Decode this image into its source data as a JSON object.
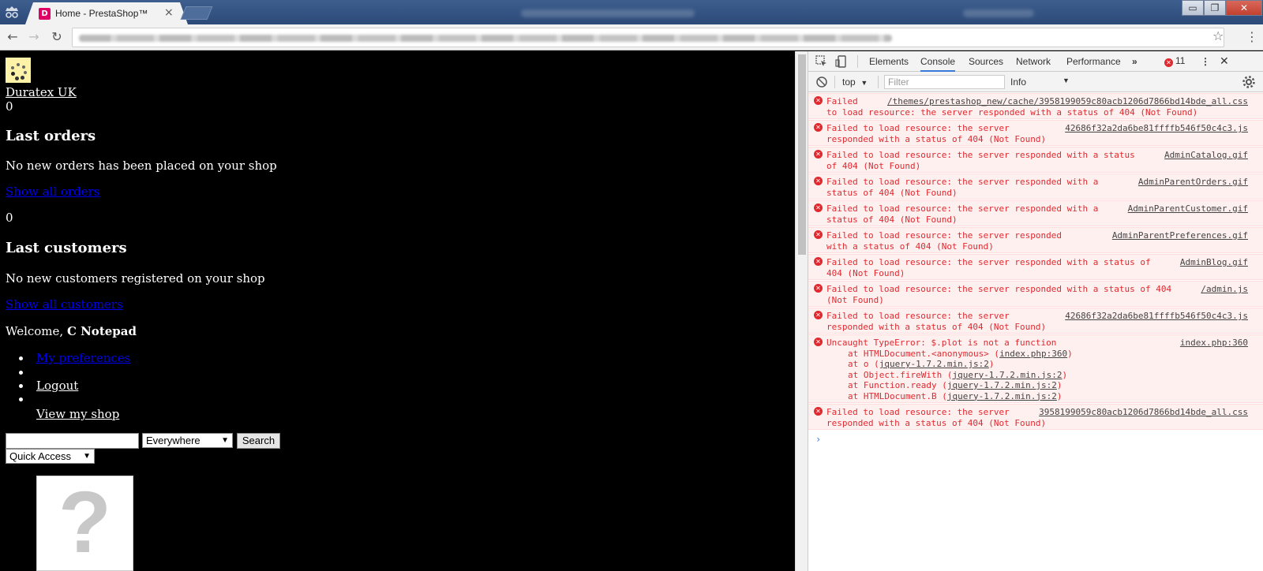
{
  "browser": {
    "tab_title": "Home - PrestaShop™",
    "tab_close": "×",
    "favicon_letter": "D",
    "brand_color": "#df0067",
    "window_controls": {
      "minimize": "▭",
      "maximize": "❐",
      "close": "✕"
    },
    "nav": {
      "back": "←",
      "forward": "→",
      "reload": "↻",
      "bookmark": "☆",
      "menu": "⋮"
    }
  },
  "page": {
    "shop_name": "Duratex UK",
    "orders_count": "0",
    "last_orders_heading": "Last orders",
    "no_orders_text": "No new orders has been placed on your shop",
    "show_all_orders": "Show all orders",
    "customers_count": "0",
    "last_customers_heading": "Last customers",
    "no_customers_text": "No new customers registered on your shop",
    "show_all_customers": "Show all customers",
    "welcome_prefix": "Welcome, ",
    "welcome_name": "C Notepad",
    "menu_links": {
      "preferences": "My preferences",
      "logout": "Logout",
      "view_shop": "View my shop"
    },
    "search": {
      "value": "",
      "scope": "Everywhere",
      "button": "Search"
    },
    "quick_access": "Quick Access",
    "placeholder_glyph": "?"
  },
  "devtools": {
    "tabs": [
      "Elements",
      "Console",
      "Sources",
      "Network",
      "Performance"
    ],
    "active_tab": "Console",
    "more_tabs": "»",
    "error_count": "11",
    "context": "top",
    "filter_placeholder": "Filter",
    "level": "Info",
    "messages": [
      {
        "text": "Failed \nto load resource: the server responded with a status of 404 (Not Found)",
        "src": "/themes/prestashop_new/cache/3958199059c80acb1206d7866bd14bde_all.css"
      },
      {
        "text": "Failed to load resource: the server\nresponded with a status of 404 (Not Found)",
        "src": "42686f32a2da6be81ffffb546f50c4c3.js"
      },
      {
        "text": "Failed to load resource: the server responded with a status\nof 404 (Not Found)",
        "src": "AdminCatalog.gif"
      },
      {
        "text": "Failed to load resource: the server responded with a\nstatus of 404 (Not Found)",
        "src": "AdminParentOrders.gif"
      },
      {
        "text": "Failed to load resource: the server responded with a\nstatus of 404 (Not Found)",
        "src": "AdminParentCustomer.gif"
      },
      {
        "text": "Failed to load resource: the server responded\nwith a status of 404 (Not Found)",
        "src": "AdminParentPreferences.gif"
      },
      {
        "text": "Failed to load resource: the server responded with a status of\n404 (Not Found)",
        "src": "AdminBlog.gif"
      },
      {
        "text": "Failed to load resource: the server responded with a status of 404\n(Not Found)",
        "src": "/admin.js"
      },
      {
        "text": "Failed to load resource: the server\nresponded with a status of 404 (Not Found)",
        "src": "42686f32a2da6be81ffffb546f50c4c3.js"
      },
      {
        "text": "Uncaught TypeError: $.plot is not a function",
        "src": "index.php:360",
        "stack": [
          {
            "pre": "at HTMLDocument.<anonymous> (",
            "link": "index.php:360",
            "post": ")"
          },
          {
            "pre": "at o (",
            "link": "jquery-1.7.2.min.js:2",
            "post": ")"
          },
          {
            "pre": "at Object.fireWith (",
            "link": "jquery-1.7.2.min.js:2",
            "post": ")"
          },
          {
            "pre": "at Function.ready (",
            "link": "jquery-1.7.2.min.js:2",
            "post": ")"
          },
          {
            "pre": "at HTMLDocument.B (",
            "link": "jquery-1.7.2.min.js:2",
            "post": ")"
          }
        ]
      },
      {
        "text": "Failed to load resource: the server\nresponded with a status of 404 (Not Found)",
        "src": "3958199059c80acb1206d7866bd14bde_all.css"
      }
    ],
    "prompt": "›",
    "error_color": "#e0292f",
    "accent_color": "#3879d9"
  }
}
